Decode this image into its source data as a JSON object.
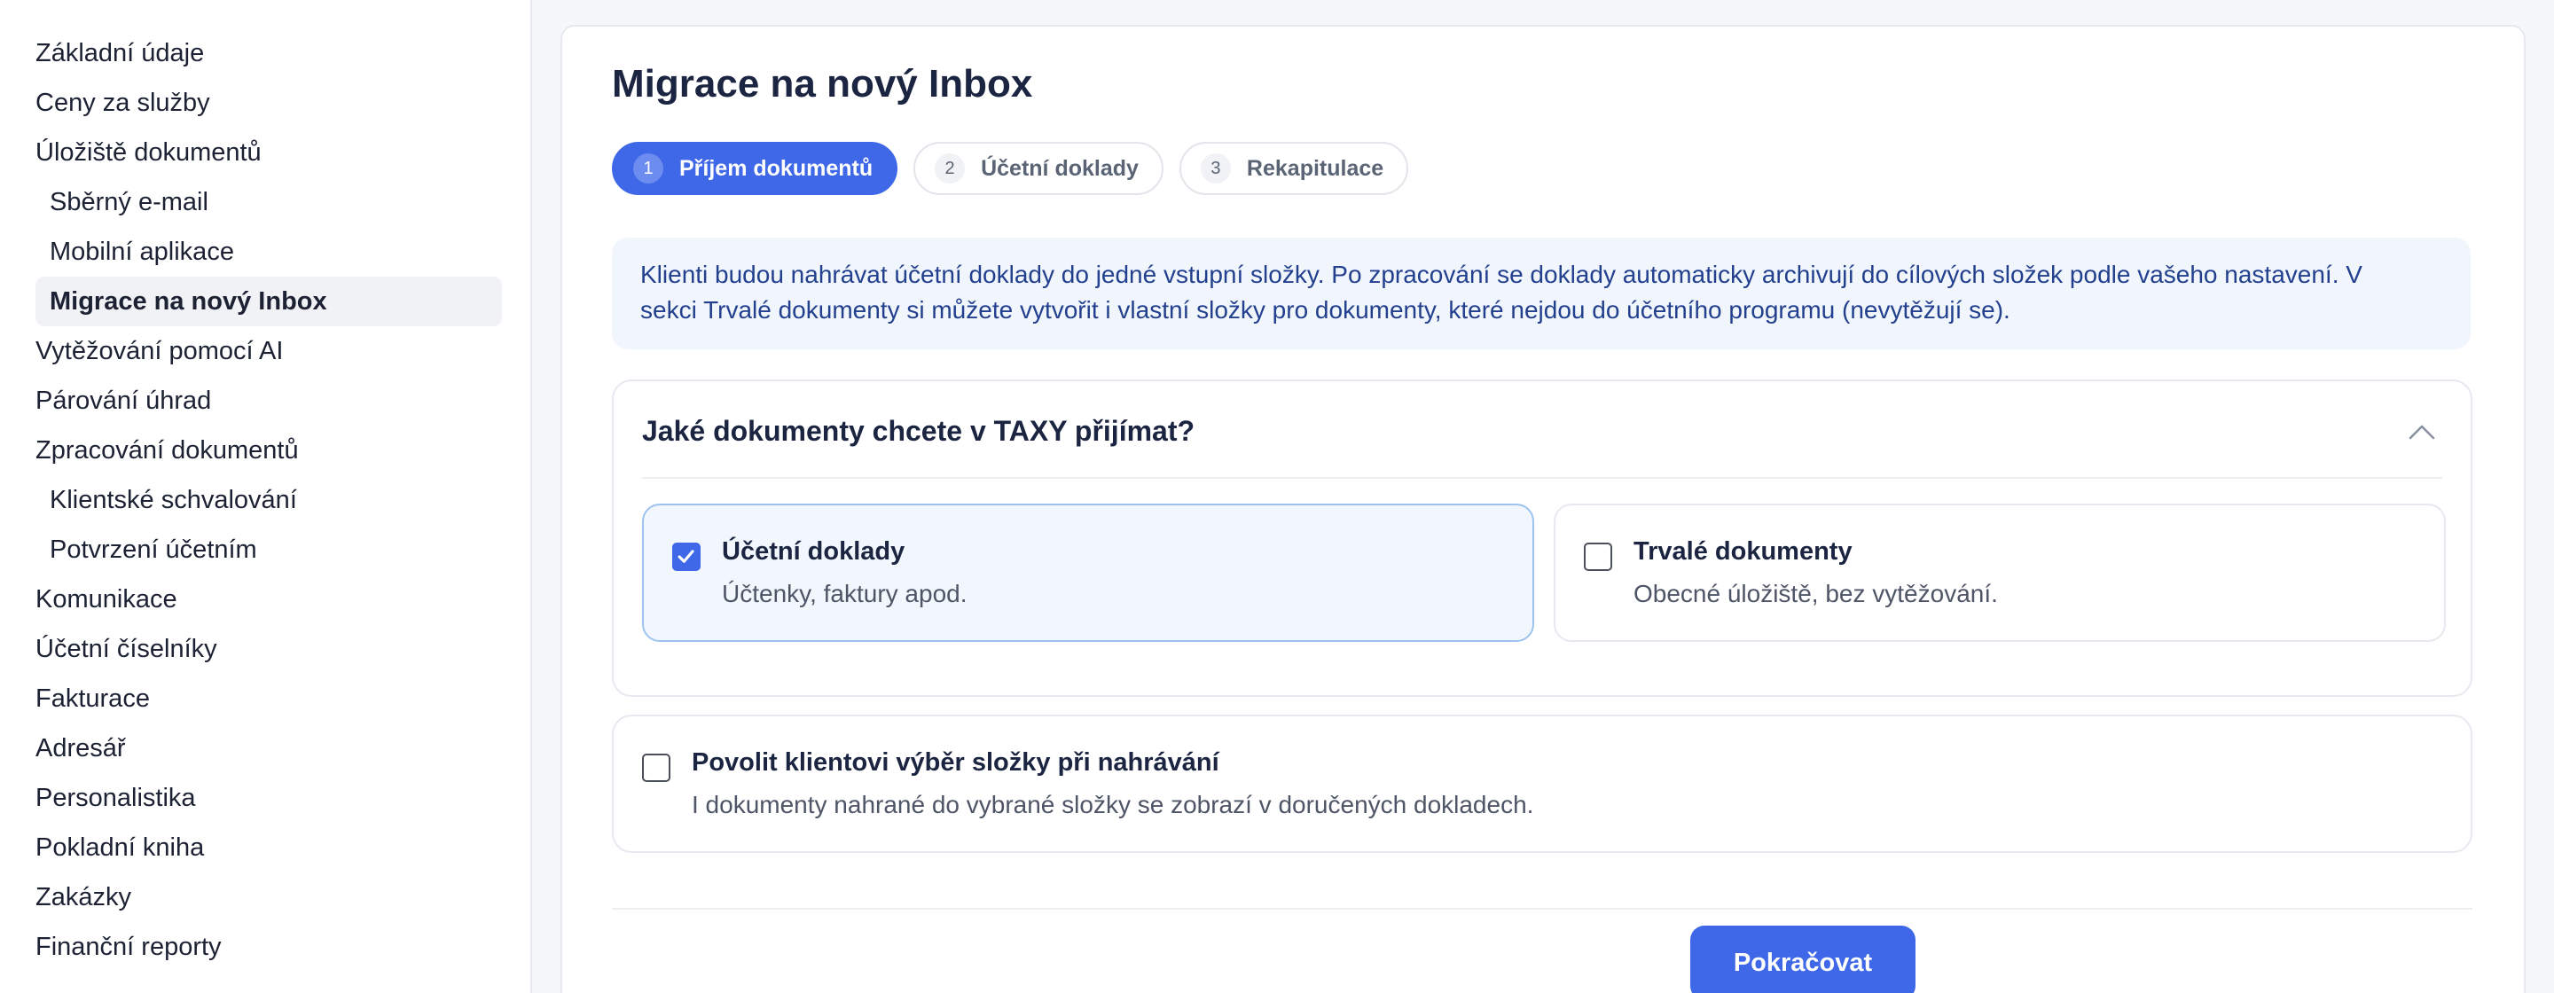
{
  "sidebar": {
    "items": [
      {
        "label": "Základní údaje"
      },
      {
        "label": "Ceny za služby"
      },
      {
        "label": "Úložiště dokumentů"
      },
      {
        "label": "Sběrný e-mail"
      },
      {
        "label": "Mobilní aplikace"
      },
      {
        "label": "Migrace na nový Inbox"
      },
      {
        "label": "Vytěžování pomocí AI"
      },
      {
        "label": "Párování úhrad"
      },
      {
        "label": "Zpracování dokumentů"
      },
      {
        "label": "Klientské schvalování"
      },
      {
        "label": "Potvrzení účetním"
      },
      {
        "label": "Komunikace"
      },
      {
        "label": "Účetní číselníky"
      },
      {
        "label": "Fakturace"
      },
      {
        "label": "Adresář"
      },
      {
        "label": "Personalistika"
      },
      {
        "label": "Pokladní kniha"
      },
      {
        "label": "Zakázky"
      },
      {
        "label": "Finanční reporty"
      }
    ]
  },
  "main": {
    "title": "Migrace na nový Inbox",
    "steps": [
      {
        "num": "1",
        "label": "Příjem dokumentů"
      },
      {
        "num": "2",
        "label": "Účetní doklady"
      },
      {
        "num": "3",
        "label": "Rekapitulace"
      }
    ],
    "info_line1": "Klienti budou nahrávat účetní doklady do jedné vstupní složky. Po zpracování se doklady automaticky archivují do cílových složek podle vašeho nastavení. V",
    "info_line2": "sekci Trvalé dokumenty si můžete vytvořit i vlastní složky pro dokumenty, které nejdou do účetního programu (nevytěžují se).",
    "section": {
      "title": "Jaké dokumenty chcete v TAXY přijímat?",
      "options": [
        {
          "title": "Účetní doklady",
          "desc": "Účtenky, faktury apod.",
          "checked": true
        },
        {
          "title": "Trvalé dokumenty",
          "desc": "Obecné úložiště, bez vytěžování.",
          "checked": false
        }
      ]
    },
    "permission": {
      "title": "Povolit klientovi výběr složky při nahrávání",
      "desc": "I dokumenty nahrané do vybrané složky se zobrazí v doručených dokladech.",
      "checked": false
    },
    "continue_label": "Pokračovat"
  },
  "colors": {
    "accent": "#3f68e8",
    "info_bg": "#f1f6fd",
    "info_text": "#23408f",
    "selected_bg": "#f1f7fd"
  },
  "icons": {
    "check": "check-icon",
    "collapse": "chevron-up-icon"
  }
}
